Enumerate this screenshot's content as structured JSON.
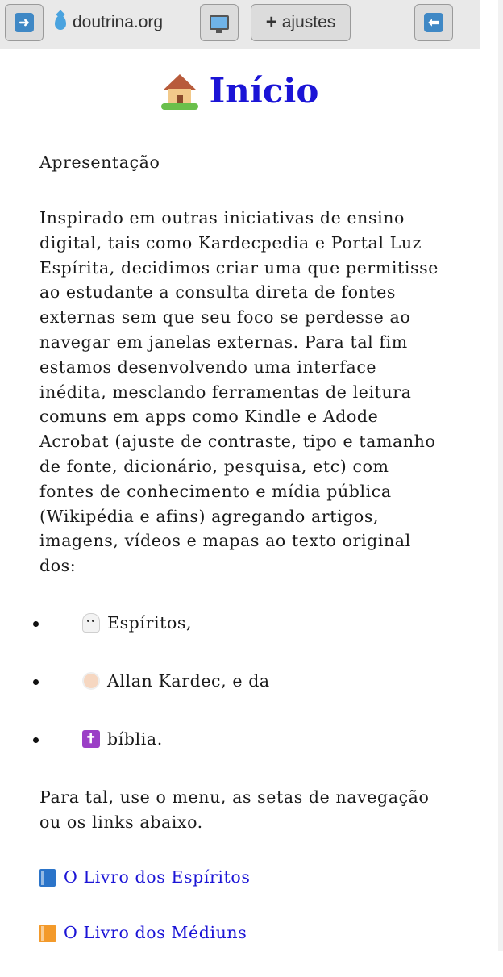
{
  "toolbar": {
    "forward_icon": "right-arrow-icon",
    "site_name": "doutrina.org",
    "settings_label": "ajustes",
    "back_icon": "left-arrow-icon",
    "accent": "#3f88c5"
  },
  "page": {
    "title": "Início",
    "subtitle": "Apresentação",
    "intro": "Inspirado em outras iniciativas de ensino digital, tais como Kardecpedia e Portal Luz Espírita, decidimos criar uma que permitisse ao estudante a consulta direta de fontes externas sem que seu foco se perdesse ao navegar em janelas externas. Para tal fim estamos desenvolvendo uma interface inédita, mesclando ferramentas de leitura comuns em apps como Kindle e Adode Acrobat (ajuste de contraste, tipo e tamanho de fonte, dicionário, pesquisa, etc) com fontes de conhecimento e mídia pública (Wikipédia e afins) agregando artigos, imagens, vídeos e mapas ao texto original dos:",
    "items": [
      {
        "icon": "ghost-icon",
        "label": "Espíritos,"
      },
      {
        "icon": "old-man-icon",
        "label": "Allan Kardec, e da"
      },
      {
        "icon": "cross-icon",
        "label": "bíblia."
      }
    ],
    "outro": "Para tal, use o menu, as setas de navegação ou os links abaixo.",
    "links": [
      {
        "icon": "blue-book-icon",
        "label": "O Livro dos Espíritos"
      },
      {
        "icon": "orange-book-icon",
        "label": "O Livro dos Médiuns"
      }
    ],
    "title_color": "#1b14d6",
    "link_color": "#1b14d6"
  }
}
